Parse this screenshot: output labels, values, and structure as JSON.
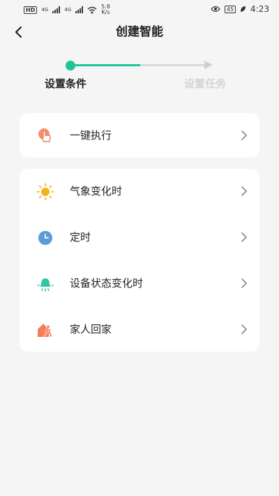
{
  "status_bar": {
    "left_badge": "HD",
    "net1": "4G",
    "net2": "4G",
    "speed_value": "5.8",
    "speed_unit": "K/s",
    "battery": "45",
    "time": "4:23"
  },
  "header": {
    "title": "创建智能",
    "back_icon": "chevron-left-icon"
  },
  "stepper": {
    "steps": [
      {
        "label": "设置条件",
        "active": true
      },
      {
        "label": "设置任务",
        "active": false
      }
    ],
    "active_color": "#1dc59b",
    "inactive_color": "#d4d4d4"
  },
  "quick_card": {
    "items": [
      {
        "label": "一键执行",
        "icon": "tap-hand-icon",
        "color": "#f07f5a"
      }
    ]
  },
  "conditions_card": {
    "items": [
      {
        "label": "气象变化时",
        "icon": "sun-icon",
        "color": "#f4b41a"
      },
      {
        "label": "定时",
        "icon": "clock-icon",
        "color": "#5b9bd9"
      },
      {
        "label": "设备状态变化时",
        "icon": "device-lamp-icon",
        "color": "#2fc7a0"
      },
      {
        "label": "家人回家",
        "icon": "home-walker-icon",
        "color": "#f07f5a"
      }
    ]
  }
}
